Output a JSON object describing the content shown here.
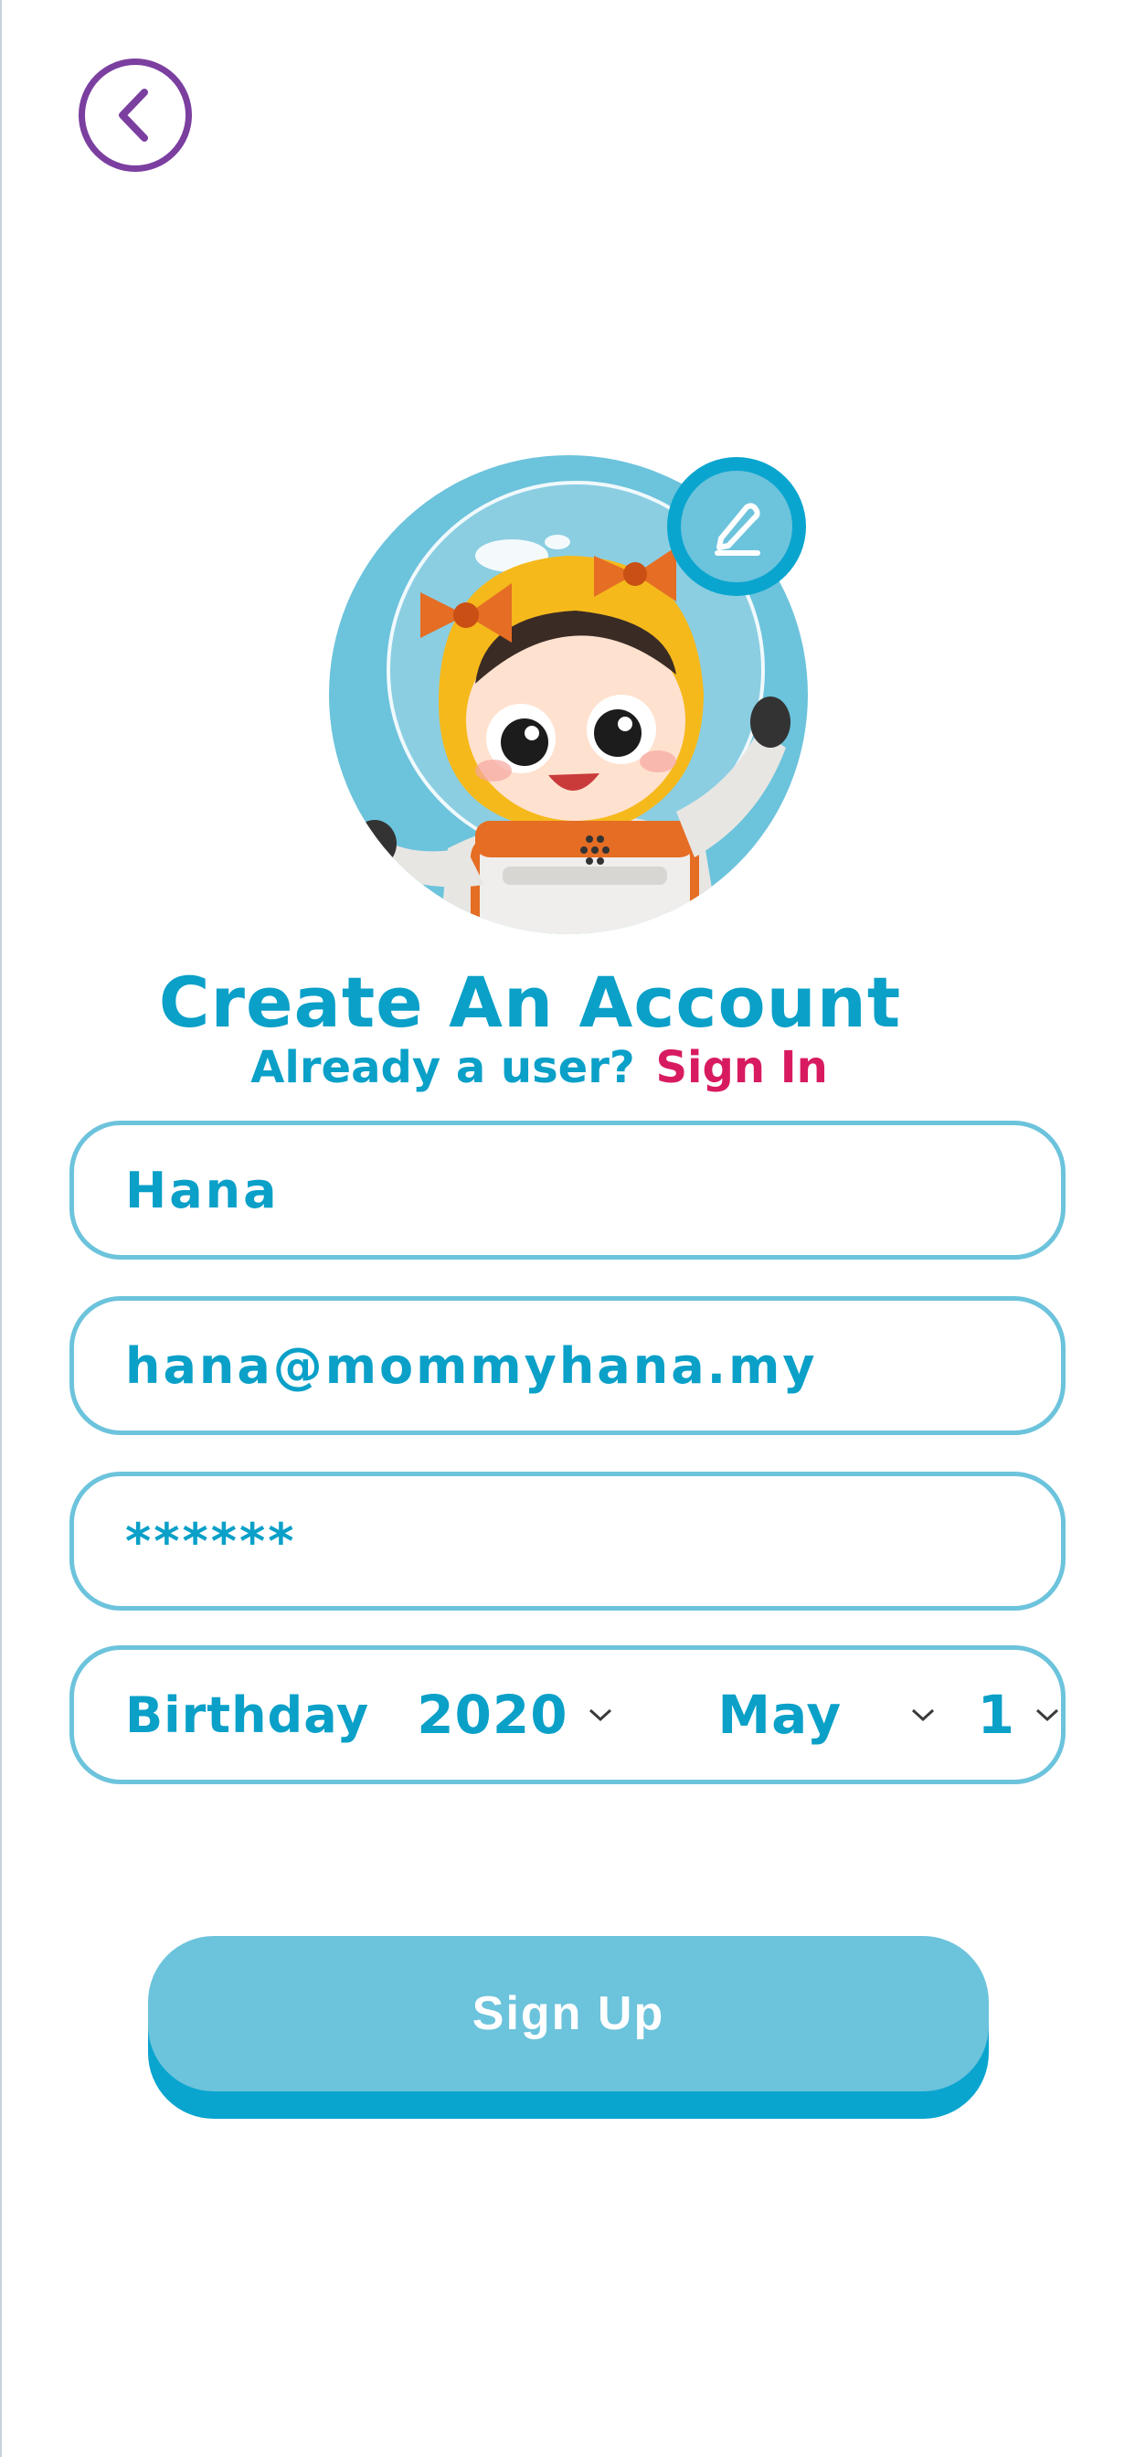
{
  "header": {
    "back_icon": "chevron-left-icon"
  },
  "avatar": {
    "edit_icon": "pencil-icon"
  },
  "title": "Create An Account",
  "subtitle": {
    "prompt": "Already a user?",
    "link": "Sign In"
  },
  "form": {
    "name_value": "Hana",
    "email_value": "hana@mommyhana.my",
    "password_value": "******",
    "birthday": {
      "label": "Birthday",
      "year": "2020",
      "month": "May",
      "day": "1"
    }
  },
  "signup_label": "Sign Up",
  "colors": {
    "primary": "#0aa0c8",
    "button": "#6cc3dc",
    "button_shadow": "#0aa5cf",
    "link": "#d81b60",
    "back": "#7b3fa0"
  }
}
